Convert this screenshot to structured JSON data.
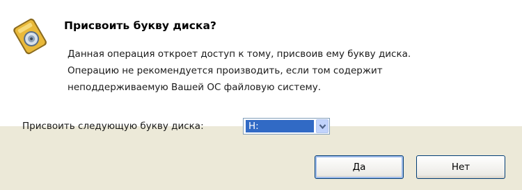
{
  "dialog": {
    "title": "Присвоить букву диска?",
    "description_lines": [
      "Данная операция откроет доступ к тому, присвоив ему букву диска.",
      "Операцию не рекомендуется производить, если том содержит",
      "неподдерживаемую Вашей ОС файловую систему."
    ],
    "icon": "drive-letter-icon"
  },
  "assign": {
    "label": "Присвоить следующую букву диска:",
    "selected_letter": "H:"
  },
  "buttons": {
    "yes_label": "Да",
    "no_label": "Нет"
  },
  "colors": {
    "dialog_bg": "#ECE9D8",
    "header_bg": "#FFFFFF",
    "selection": "#316AC5",
    "button_border": "#003C74"
  }
}
